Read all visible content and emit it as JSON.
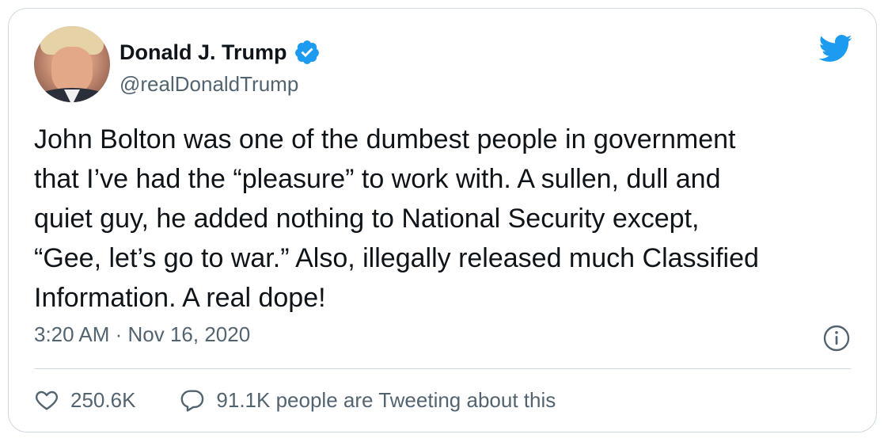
{
  "tweet": {
    "author_name": "Donald J. Trump",
    "author_handle": "@realDonaldTrump",
    "text": "John Bolton was one of the dumbest people in government\nthat I’ve had the “pleasure” to work with. A sullen, dull and\nquiet guy, he added nothing to National Security except,\n“Gee, let’s go to war.” Also, illegally released much Classified\nInformation. A real dope!",
    "timestamp": "3:20 AM · Nov 16, 2020",
    "likes": "250.6K",
    "conversation": "91.1K people are Tweeting about this"
  },
  "icons": {
    "verified": "verified-badge-icon",
    "brand": "twitter-bird-icon",
    "info": "info-icon",
    "like": "heart-icon",
    "reply": "speech-bubble-icon"
  },
  "colors": {
    "brand_blue": "#1d9bf0",
    "text_primary": "#0f1419",
    "text_secondary": "#536471",
    "border": "#cfd9de"
  }
}
